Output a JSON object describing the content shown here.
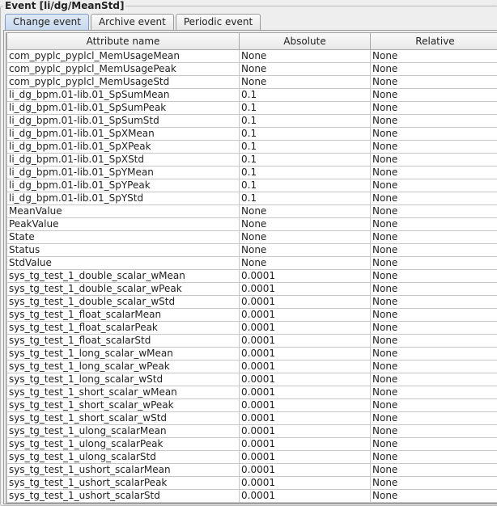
{
  "group_title": "Event [li/dg/MeanStd]",
  "tabs": [
    {
      "label": "Change event",
      "active": true
    },
    {
      "label": "Archive event",
      "active": false
    },
    {
      "label": "Periodic event",
      "active": false
    }
  ],
  "table": {
    "columns": [
      "Attribute name",
      "Absolute",
      "Relative"
    ],
    "rows": [
      [
        "com_pyplc_pyplcl_MemUsageMean",
        "None",
        "None"
      ],
      [
        "com_pyplc_pyplcl_MemUsagePeak",
        "None",
        "None"
      ],
      [
        "com_pyplc_pyplcl_MemUsageStd",
        "None",
        "None"
      ],
      [
        "li_dg_bpm.01-lib.01_SpSumMean",
        "0.1",
        "None"
      ],
      [
        "li_dg_bpm.01-lib.01_SpSumPeak",
        "0.1",
        "None"
      ],
      [
        "li_dg_bpm.01-lib.01_SpSumStd",
        "0.1",
        "None"
      ],
      [
        "li_dg_bpm.01-lib.01_SpXMean",
        "0.1",
        "None"
      ],
      [
        "li_dg_bpm.01-lib.01_SpXPeak",
        "0.1",
        "None"
      ],
      [
        "li_dg_bpm.01-lib.01_SpXStd",
        "0.1",
        "None"
      ],
      [
        "li_dg_bpm.01-lib.01_SpYMean",
        "0.1",
        "None"
      ],
      [
        "li_dg_bpm.01-lib.01_SpYPeak",
        "0.1",
        "None"
      ],
      [
        "li_dg_bpm.01-lib.01_SpYStd",
        "0.1",
        "None"
      ],
      [
        "MeanValue",
        "None",
        "None"
      ],
      [
        "PeakValue",
        "None",
        "None"
      ],
      [
        "State",
        "None",
        "None"
      ],
      [
        "Status",
        "None",
        "None"
      ],
      [
        "StdValue",
        "None",
        "None"
      ],
      [
        "sys_tg_test_1_double_scalar_wMean",
        "0.0001",
        "None"
      ],
      [
        "sys_tg_test_1_double_scalar_wPeak",
        "0.0001",
        "None"
      ],
      [
        "sys_tg_test_1_double_scalar_wStd",
        "0.0001",
        "None"
      ],
      [
        "sys_tg_test_1_float_scalarMean",
        "0.0001",
        "None"
      ],
      [
        "sys_tg_test_1_float_scalarPeak",
        "0.0001",
        "None"
      ],
      [
        "sys_tg_test_1_float_scalarStd",
        "0.0001",
        "None"
      ],
      [
        "sys_tg_test_1_long_scalar_wMean",
        "0.0001",
        "None"
      ],
      [
        "sys_tg_test_1_long_scalar_wPeak",
        "0.0001",
        "None"
      ],
      [
        "sys_tg_test_1_long_scalar_wStd",
        "0.0001",
        "None"
      ],
      [
        "sys_tg_test_1_short_scalar_wMean",
        "0.0001",
        "None"
      ],
      [
        "sys_tg_test_1_short_scalar_wPeak",
        "0.0001",
        "None"
      ],
      [
        "sys_tg_test_1_short_scalar_wStd",
        "0.0001",
        "None"
      ],
      [
        "sys_tg_test_1_ulong_scalarMean",
        "0.0001",
        "None"
      ],
      [
        "sys_tg_test_1_ulong_scalarPeak",
        "0.0001",
        "None"
      ],
      [
        "sys_tg_test_1_ulong_scalarStd",
        "0.0001",
        "None"
      ],
      [
        "sys_tg_test_1_ushort_scalarMean",
        "0.0001",
        "None"
      ],
      [
        "sys_tg_test_1_ushort_scalarPeak",
        "0.0001",
        "None"
      ],
      [
        "sys_tg_test_1_ushort_scalarStd",
        "0.0001",
        "None"
      ]
    ]
  }
}
